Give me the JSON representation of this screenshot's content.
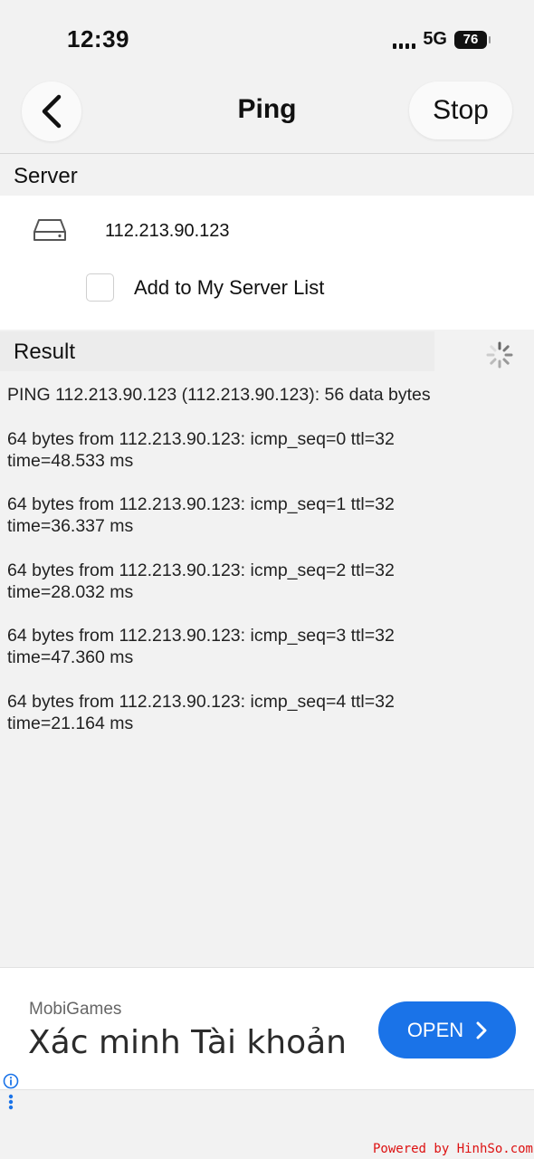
{
  "status_bar": {
    "time": "12:39",
    "network": "5G",
    "battery": "76"
  },
  "nav": {
    "title": "Ping",
    "stop_label": "Stop"
  },
  "server": {
    "section_label": "Server",
    "address": "112.213.90.123",
    "add_to_list_label": "Add to My Server List",
    "add_to_list_checked": false
  },
  "result": {
    "section_label": "Result",
    "header_line": "PING 112.213.90.123 (112.213.90.123): 56 data bytes",
    "replies": [
      {
        "line1": "64 bytes from 112.213.90.123: icmp_seq=0 ttl=32",
        "line2": "time=48.533 ms"
      },
      {
        "line1": "64 bytes from 112.213.90.123: icmp_seq=1 ttl=32",
        "line2": "time=36.337 ms"
      },
      {
        "line1": "64 bytes from 112.213.90.123: icmp_seq=2 ttl=32",
        "line2": "time=28.032 ms"
      },
      {
        "line1": "64 bytes from 112.213.90.123: icmp_seq=3 ttl=32",
        "line2": "time=47.360 ms"
      },
      {
        "line1": "64 bytes from 112.213.90.123: icmp_seq=4 ttl=32",
        "line2": "time=21.164 ms"
      }
    ]
  },
  "ad": {
    "sponsor": "MobiGames",
    "headline": "Xác minh Tài khoản",
    "button_label": "OPEN",
    "button_color": "#1a73e8"
  },
  "footer": {
    "powered_by": "Powered by HinhSo.com"
  },
  "icons": {
    "back": "chevron-left-icon",
    "drive": "drive-icon",
    "spinner": "loading-spinner-icon",
    "chevron": "chevron-right-icon",
    "info": "info-icon",
    "more": "more-vertical-icon"
  }
}
